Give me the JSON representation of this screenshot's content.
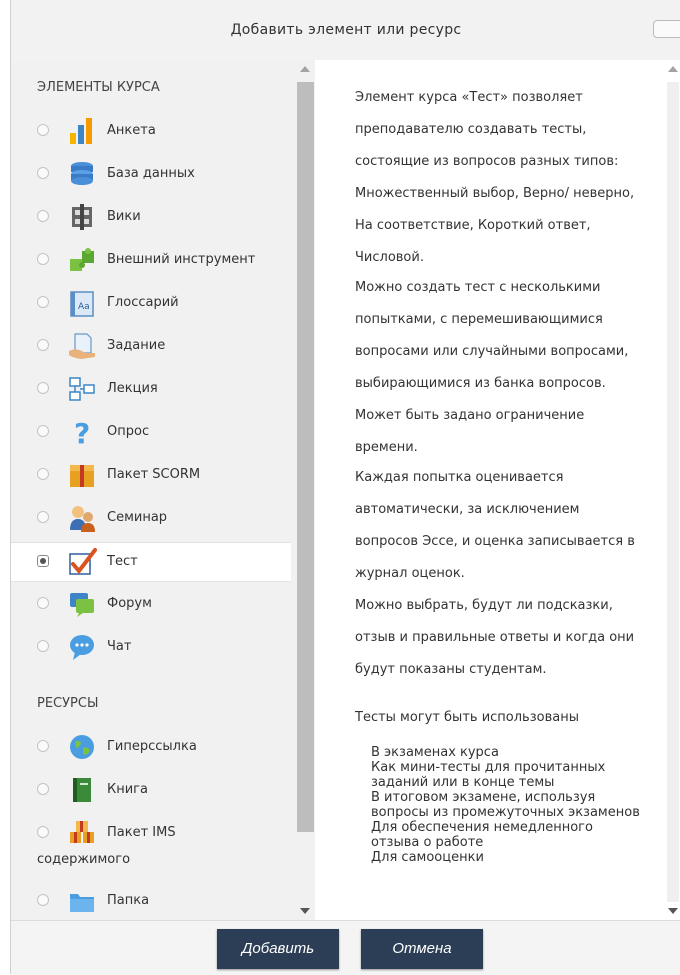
{
  "dialog": {
    "title": "Добавить элемент или ресурс"
  },
  "options": {
    "sections": {
      "activities": "ЭЛЕМЕНТЫ КУРСА",
      "resources": "РЕСУРСЫ"
    },
    "activities": [
      {
        "label": "Анкета",
        "icon": "chart-bars-icon"
      },
      {
        "label": "База данных",
        "icon": "database-icon"
      },
      {
        "label": "Вики",
        "icon": "wiki-icon"
      },
      {
        "label": "Внешний инструмент",
        "icon": "puzzle-icon"
      },
      {
        "label": "Глоссарий",
        "icon": "glossary-icon"
      },
      {
        "label": "Задание",
        "icon": "assignment-icon"
      },
      {
        "label": "Лекция",
        "icon": "lesson-icon"
      },
      {
        "label": "Опрос",
        "icon": "question-icon"
      },
      {
        "label": "Пакет SCORM",
        "icon": "package-icon"
      },
      {
        "label": "Семинар",
        "icon": "workshop-icon"
      },
      {
        "label": "Тест",
        "icon": "checkmark-icon",
        "selected": true
      },
      {
        "label": "Форум",
        "icon": "forum-icon"
      },
      {
        "label": "Чат",
        "icon": "chat-icon"
      }
    ],
    "resources": [
      {
        "label": "Гиперссылка",
        "icon": "globe-icon"
      },
      {
        "label": "Книга",
        "icon": "book-icon"
      },
      {
        "label": "Пакет IMS",
        "label_line2": "содержимого",
        "icon": "ims-package-icon"
      },
      {
        "label": "Папка",
        "icon": "folder-icon"
      }
    ]
  },
  "help": {
    "paragraphs": [
      "Элемент курса «Тест» позволяет преподавателю создавать тесты, состоящие из вопросов разных типов: Множественный выбор, Верно/ неверно, На соответствие, Короткий ответ, Числовой.",
      "Можно создать тест с несколькими попытками, с перемешивающимися вопросами или случайными вопросами, выбирающимися из банка вопросов. Может быть задано ограничение времени.",
      "Каждая попытка оценивается автоматически, за исключением вопросов Эссе, и оценка записывается в журнал оценок.",
      "Можно выбрать, будут ли подсказки, отзыв и правильные ответы и когда они будут показаны студентам.",
      "Тесты могут быть использованы"
    ],
    "list": [
      "В экзаменах курса",
      "Как мини-тесты для прочитанных заданий или в конце темы",
      "В итоговом экзамене, используя вопросы из промежуточных экзаменов",
      "Для обеспечения немедленного отзыва о работе",
      "Для самооценки"
    ]
  },
  "footer": {
    "add_label": "Добавить",
    "cancel_label": "Отмена"
  },
  "colors": {
    "button_bg": "#2c3e55",
    "selected_row_bg": "#ffffff",
    "list_bg": "#f1f1f1"
  }
}
